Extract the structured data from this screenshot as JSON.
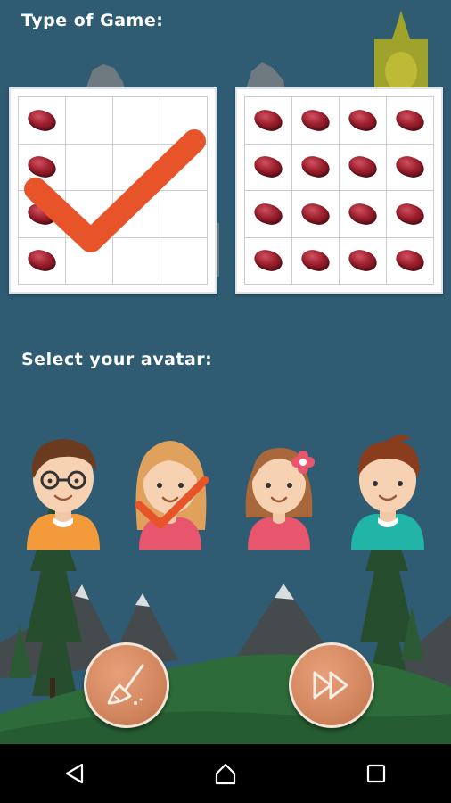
{
  "header": {
    "game_type_title": "Type of Game:"
  },
  "boards": [
    {
      "name": "small-board",
      "bean_cells": [
        0,
        4,
        8,
        12
      ],
      "selected": true
    },
    {
      "name": "full-board",
      "bean_cells": [
        0,
        1,
        2,
        3,
        4,
        5,
        6,
        7,
        8,
        9,
        10,
        11,
        12,
        13,
        14,
        15
      ],
      "selected": false
    }
  ],
  "avatar_section": {
    "title": "Select your avatar:"
  },
  "avatars": [
    {
      "id": "boy-glasses",
      "shirt_color": "#f39a3b",
      "hair_color": "#6b3b1f",
      "selected": false
    },
    {
      "id": "girl-blonde",
      "shirt_color": "#e8566e",
      "hair_color": "#e0a15c",
      "selected": true
    },
    {
      "id": "girl-flower",
      "shirt_color": "#e8566e",
      "hair_color": "#a8683b",
      "selected": false
    },
    {
      "id": "boy-plain",
      "shirt_color": "#21b5a8",
      "hair_color": "#8a3d1d",
      "selected": false
    }
  ],
  "actions": {
    "clear_icon": "broom-icon",
    "next_icon": "fast-forward-icon"
  },
  "navbar": {
    "back_icon": "back-triangle-icon",
    "home_icon": "home-icon",
    "recents_icon": "recents-square-icon"
  },
  "colors": {
    "background": "#2f5b73",
    "check": "#e8542a",
    "ground": "#2e6b3a",
    "button": "#d2865e"
  }
}
